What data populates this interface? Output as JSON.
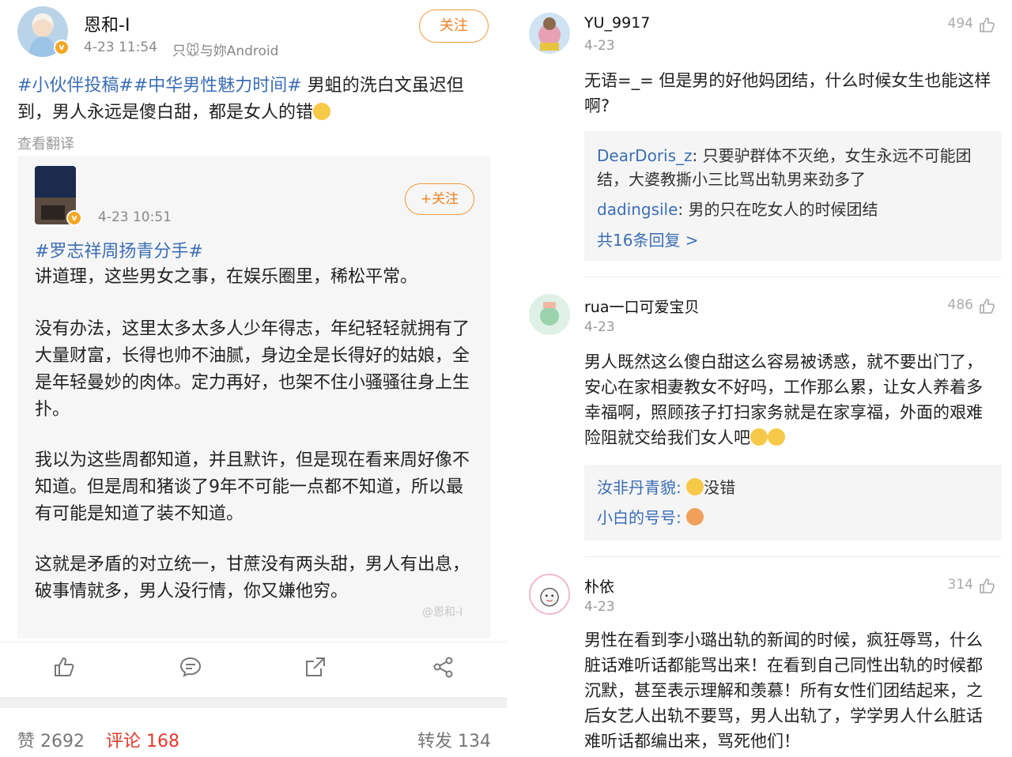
{
  "post": {
    "author": "恩和-I",
    "time": "4-23 11:54",
    "source": "只🐭与妳Android",
    "follow_label": "关注",
    "topic1": "#小伙伴投稿#",
    "topic2": "#中华男性魅力时间#",
    "text": " 男蛆的洗白文虽迟但到，男人永远是傻白甜，都是女人的错",
    "translate_label": "查看翻译"
  },
  "quoted": {
    "time": "4-23 10:51",
    "follow_label": "+关注",
    "topic": "#罗志祥周扬青分手#",
    "paragraphs": [
      "讲道理，这些男女之事，在娱乐圈里，稀松平常。",
      "没有办法，这里太多太多人少年得志，年纪轻轻就拥有了大量财富，长得也帅不油腻，身边全是长得好的姑娘，全是年轻曼妙的肉体。定力再好，也架不住小骚骚往身上生扑。",
      "我以为这些周都知道，并且默许，但是现在看来周好像不知道。但是周和猪谈了9年不可能一点都不知道，所以最有可能是知道了装不知道。",
      "这就是矛盾的对立统一，甘蔗没有两头甜，男人有出息，破事情就多，男人没行情，你又嫌他穷。"
    ],
    "watermark": "@恩和-I"
  },
  "stats": {
    "likes": "赞 2692",
    "comments": "评论 168",
    "reposts": "转发 134"
  },
  "comments": [
    {
      "user": "YU_9917",
      "date": "4-23",
      "likes": "494",
      "text": "无语=_=  但是男的好他妈团结，什么时候女生也能这样啊?",
      "replies": [
        {
          "user": "DearDoris_z",
          "text": "只要驴群体不灭绝，女生永远不可能团结，大婆教撕小三比骂出轨男来劲多了"
        },
        {
          "user": "dadingsile",
          "text": "男的只在吃女人的时候团结"
        }
      ],
      "more": "共16条回复 >"
    },
    {
      "user": "rua一口可爱宝贝",
      "date": "4-23",
      "likes": "486",
      "text": "男人既然这么傻白甜这么容易被诱惑，就不要出门了，安心在家相妻教女不好吗，工作那么累，让女人养着多幸福啊，照顾孩子打扫家务就是在家享福，外面的艰难险阻就交给我们女人吧",
      "replies": [
        {
          "user": "汝非丹青貌",
          "text": "没错"
        },
        {
          "user": "小白的号号",
          "text": ""
        }
      ]
    },
    {
      "user": "朴依",
      "date": "4-23",
      "likes": "314",
      "text": "男性在看到李小璐出轨的新闻的时候，疯狂辱骂，什么脏话难听话都能骂出来！在看到自己同性出轨的时候都沉默，甚至表示理解和羡慕！所有女性们团结起来，之后女艺人出轨不要骂，男人出轨了，学学男人什么脏话难听话都编出来，骂死他们！"
    }
  ],
  "colors": {
    "link": "#3b6eb5",
    "accent": "#f08020",
    "active_stat": "#e23a2e"
  },
  "icons": [
    "like-icon",
    "comment-icon",
    "share-icon",
    "forward-icon"
  ]
}
